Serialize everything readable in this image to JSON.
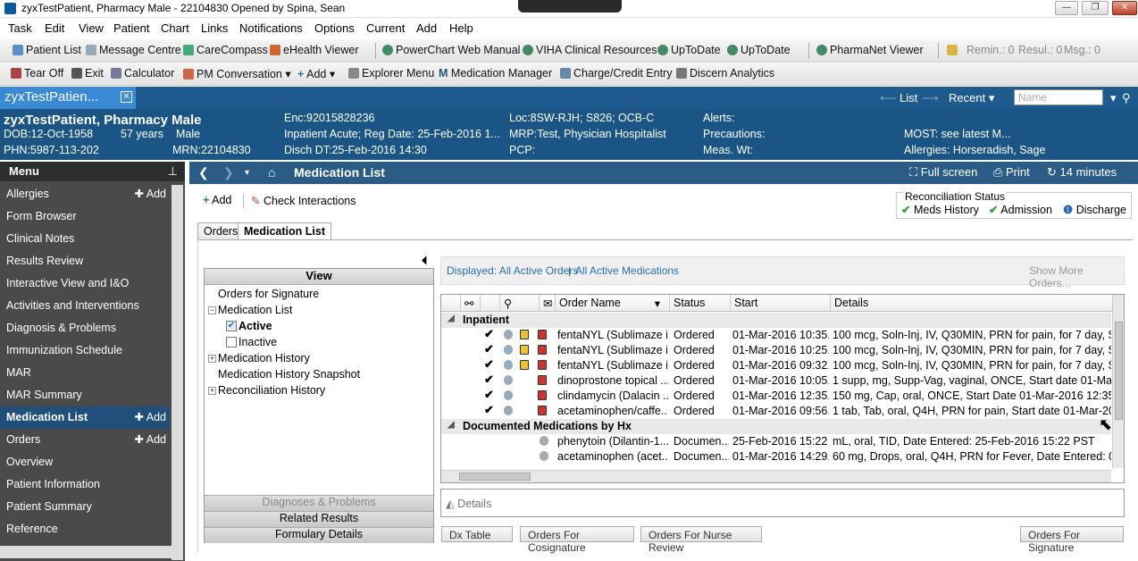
{
  "window": {
    "title": "zyxTestPatient, Pharmacy Male - 22104830 Opened by Spina, Sean"
  },
  "menubar": [
    "Task",
    "Edit",
    "View",
    "Patient",
    "Chart",
    "Links",
    "Notifications",
    "Options",
    "Current",
    "Add",
    "Help"
  ],
  "toolbar1": {
    "items": [
      "Patient List",
      "Message Centre",
      "CareCompass",
      "eHealth Viewer",
      "PowerChart Web Manual",
      "VIHA Clinical Resources",
      "UpToDate",
      "UpToDate",
      "PharmaNet Viewer"
    ],
    "status": {
      "remin": "Remin.: 0",
      "resul": "Resul.: 0",
      "msg": "Msg.: 0"
    }
  },
  "toolbar2": {
    "items": [
      "Tear Off",
      "Exit",
      "Calculator",
      "PM Conversation",
      "Add",
      "Explorer Menu",
      "Medication Manager",
      "Charge/Credit Entry",
      "Discern Analytics"
    ]
  },
  "tabstrip": {
    "patient_tab": "zyxTestPatien...",
    "list": "List",
    "recent": "Recent",
    "name_placeholder": "Name"
  },
  "banner": {
    "name": "zyxTestPatient, Pharmacy Male",
    "dob": "DOB:12-Oct-1958",
    "age": "57 years",
    "sex": "Male",
    "phn": "PHN:5987-113-202",
    "mrn": "MRN:22104830",
    "enc": "Enc:92015828236",
    "encounter": "Inpatient Acute; Reg Date: 25-Feb-2016 1...",
    "disch": "Disch DT:25-Feb-2016 14:30",
    "loc": "Loc:8SW-RJH; S826; OCB-C",
    "mrp": "MRP:Test, Physician Hospitalist",
    "pcp": "PCP:",
    "alerts": "Alerts:",
    "precautions": "Precautions:",
    "meas": "Meas. Wt:",
    "most": "MOST: see latest M...",
    "allergies": "Allergies: Horseradish, Sage"
  },
  "leftnav": {
    "header": "Menu",
    "items": [
      {
        "label": "Allergies",
        "add": "Add"
      },
      {
        "label": "Form Browser"
      },
      {
        "label": "Clinical Notes"
      },
      {
        "label": "Results Review"
      },
      {
        "label": "Interactive View and I&O"
      },
      {
        "label": "Activities and Interventions"
      },
      {
        "label": "Diagnosis & Problems"
      },
      {
        "label": "Immunization Schedule"
      },
      {
        "label": "MAR"
      },
      {
        "label": "MAR Summary"
      },
      {
        "label": "Medication List",
        "add": "Add"
      },
      {
        "label": "Orders",
        "add": "Add"
      },
      {
        "label": "Overview"
      },
      {
        "label": "Patient Information"
      },
      {
        "label": "Patient Summary"
      },
      {
        "label": "Reference"
      }
    ]
  },
  "content_header": {
    "title": "Medication List",
    "full_screen": "Full screen",
    "print": "Print",
    "refresh": "14 minutes ago"
  },
  "actions": {
    "add": "Add",
    "check": "Check Interactions"
  },
  "reconciliation": {
    "title": "Reconciliation Status",
    "meds_history": "Meds History",
    "admission": "Admission",
    "discharge": "Discharge"
  },
  "tabs": [
    "Orders",
    "Medication List"
  ],
  "view": {
    "header": "View",
    "orders_for_signature": "Orders for Signature",
    "medication_list": "Medication List",
    "active": "Active",
    "inactive": "Inactive",
    "medication_history": "Medication History",
    "history_snapshot": "Medication History Snapshot",
    "reconciliation_history": "Reconciliation History",
    "footer": [
      "Diagnoses & Problems",
      "Related Results",
      "Formulary Details"
    ]
  },
  "displayed": {
    "active_orders": "Displayed: All Active Orders",
    "active_meds": "All Active Medications",
    "show_more": "Show More Orders..."
  },
  "grid": {
    "columns": [
      "Order Name",
      "Status",
      "Start",
      "Details"
    ],
    "groups": {
      "inpatient": "Inpatient",
      "documented": "Documented Medications by Hx"
    },
    "inpatient_rows": [
      {
        "name": "fentaNYL (Sublimaze i...",
        "status": "Ordered",
        "start": "01-Mar-2016 10:35...",
        "details": "100 mcg, Soln-Inj, IV, Q30MIN, PRN for pain, for 7 day, Start"
      },
      {
        "name": "fentaNYL (Sublimaze i...",
        "status": "Ordered",
        "start": "01-Mar-2016 10:25...",
        "details": "100 mcg, Soln-Inj, IV, Q30MIN, PRN for pain, for 7 day, Start"
      },
      {
        "name": "fentaNYL (Sublimaze i...",
        "status": "Ordered",
        "start": "01-Mar-2016 09:32...",
        "details": "100 mcg, Soln-Inj, IV, Q30MIN, PRN for pain, for 7 day, Start"
      },
      {
        "name": "dinoprostone topical ...",
        "status": "Ordered",
        "start": "01-Mar-2016 10:05...",
        "details": "1 supp, mg, Supp-Vag, vaginal, ONCE, Start date 01-Mar-20"
      },
      {
        "name": "clindamycin (Dalacin ...",
        "status": "Ordered",
        "start": "01-Mar-2016 12:35...",
        "details": "150 mg, Cap, oral, ONCE, Start Date 01-Mar-2016 12:35 PST"
      },
      {
        "name": "acetaminophen/caffe...",
        "status": "Ordered",
        "start": "01-Mar-2016 09:56...",
        "details": "1 tab, Tab, oral, Q4H, PRN for pain, Start date 01-Mar-2016 0"
      }
    ],
    "documented_rows": [
      {
        "name": "phenytoin (Dilantin-1...",
        "status": "Documen...",
        "start": "25-Feb-2016 15:22 ...",
        "details": "mL, oral, TID, Date Entered: 25-Feb-2016 15:22 PST"
      },
      {
        "name": "acetaminophen (acet...",
        "status": "Documen...",
        "start": "01-Mar-2016 14:29...",
        "details": "60 mg, Drops, oral, Q4H, PRN for Fever, Date Entered: 01-M"
      }
    ]
  },
  "details_label": "Details",
  "bottom_buttons": [
    "Dx Table",
    "Orders For Cosignature",
    "Orders For Nurse Review",
    "Orders For Signature"
  ],
  "colors": {
    "banner": "#1a5585",
    "active_tab": "#3a8ad6",
    "nav": "#4a4a4a",
    "link": "#2a6cb0"
  }
}
